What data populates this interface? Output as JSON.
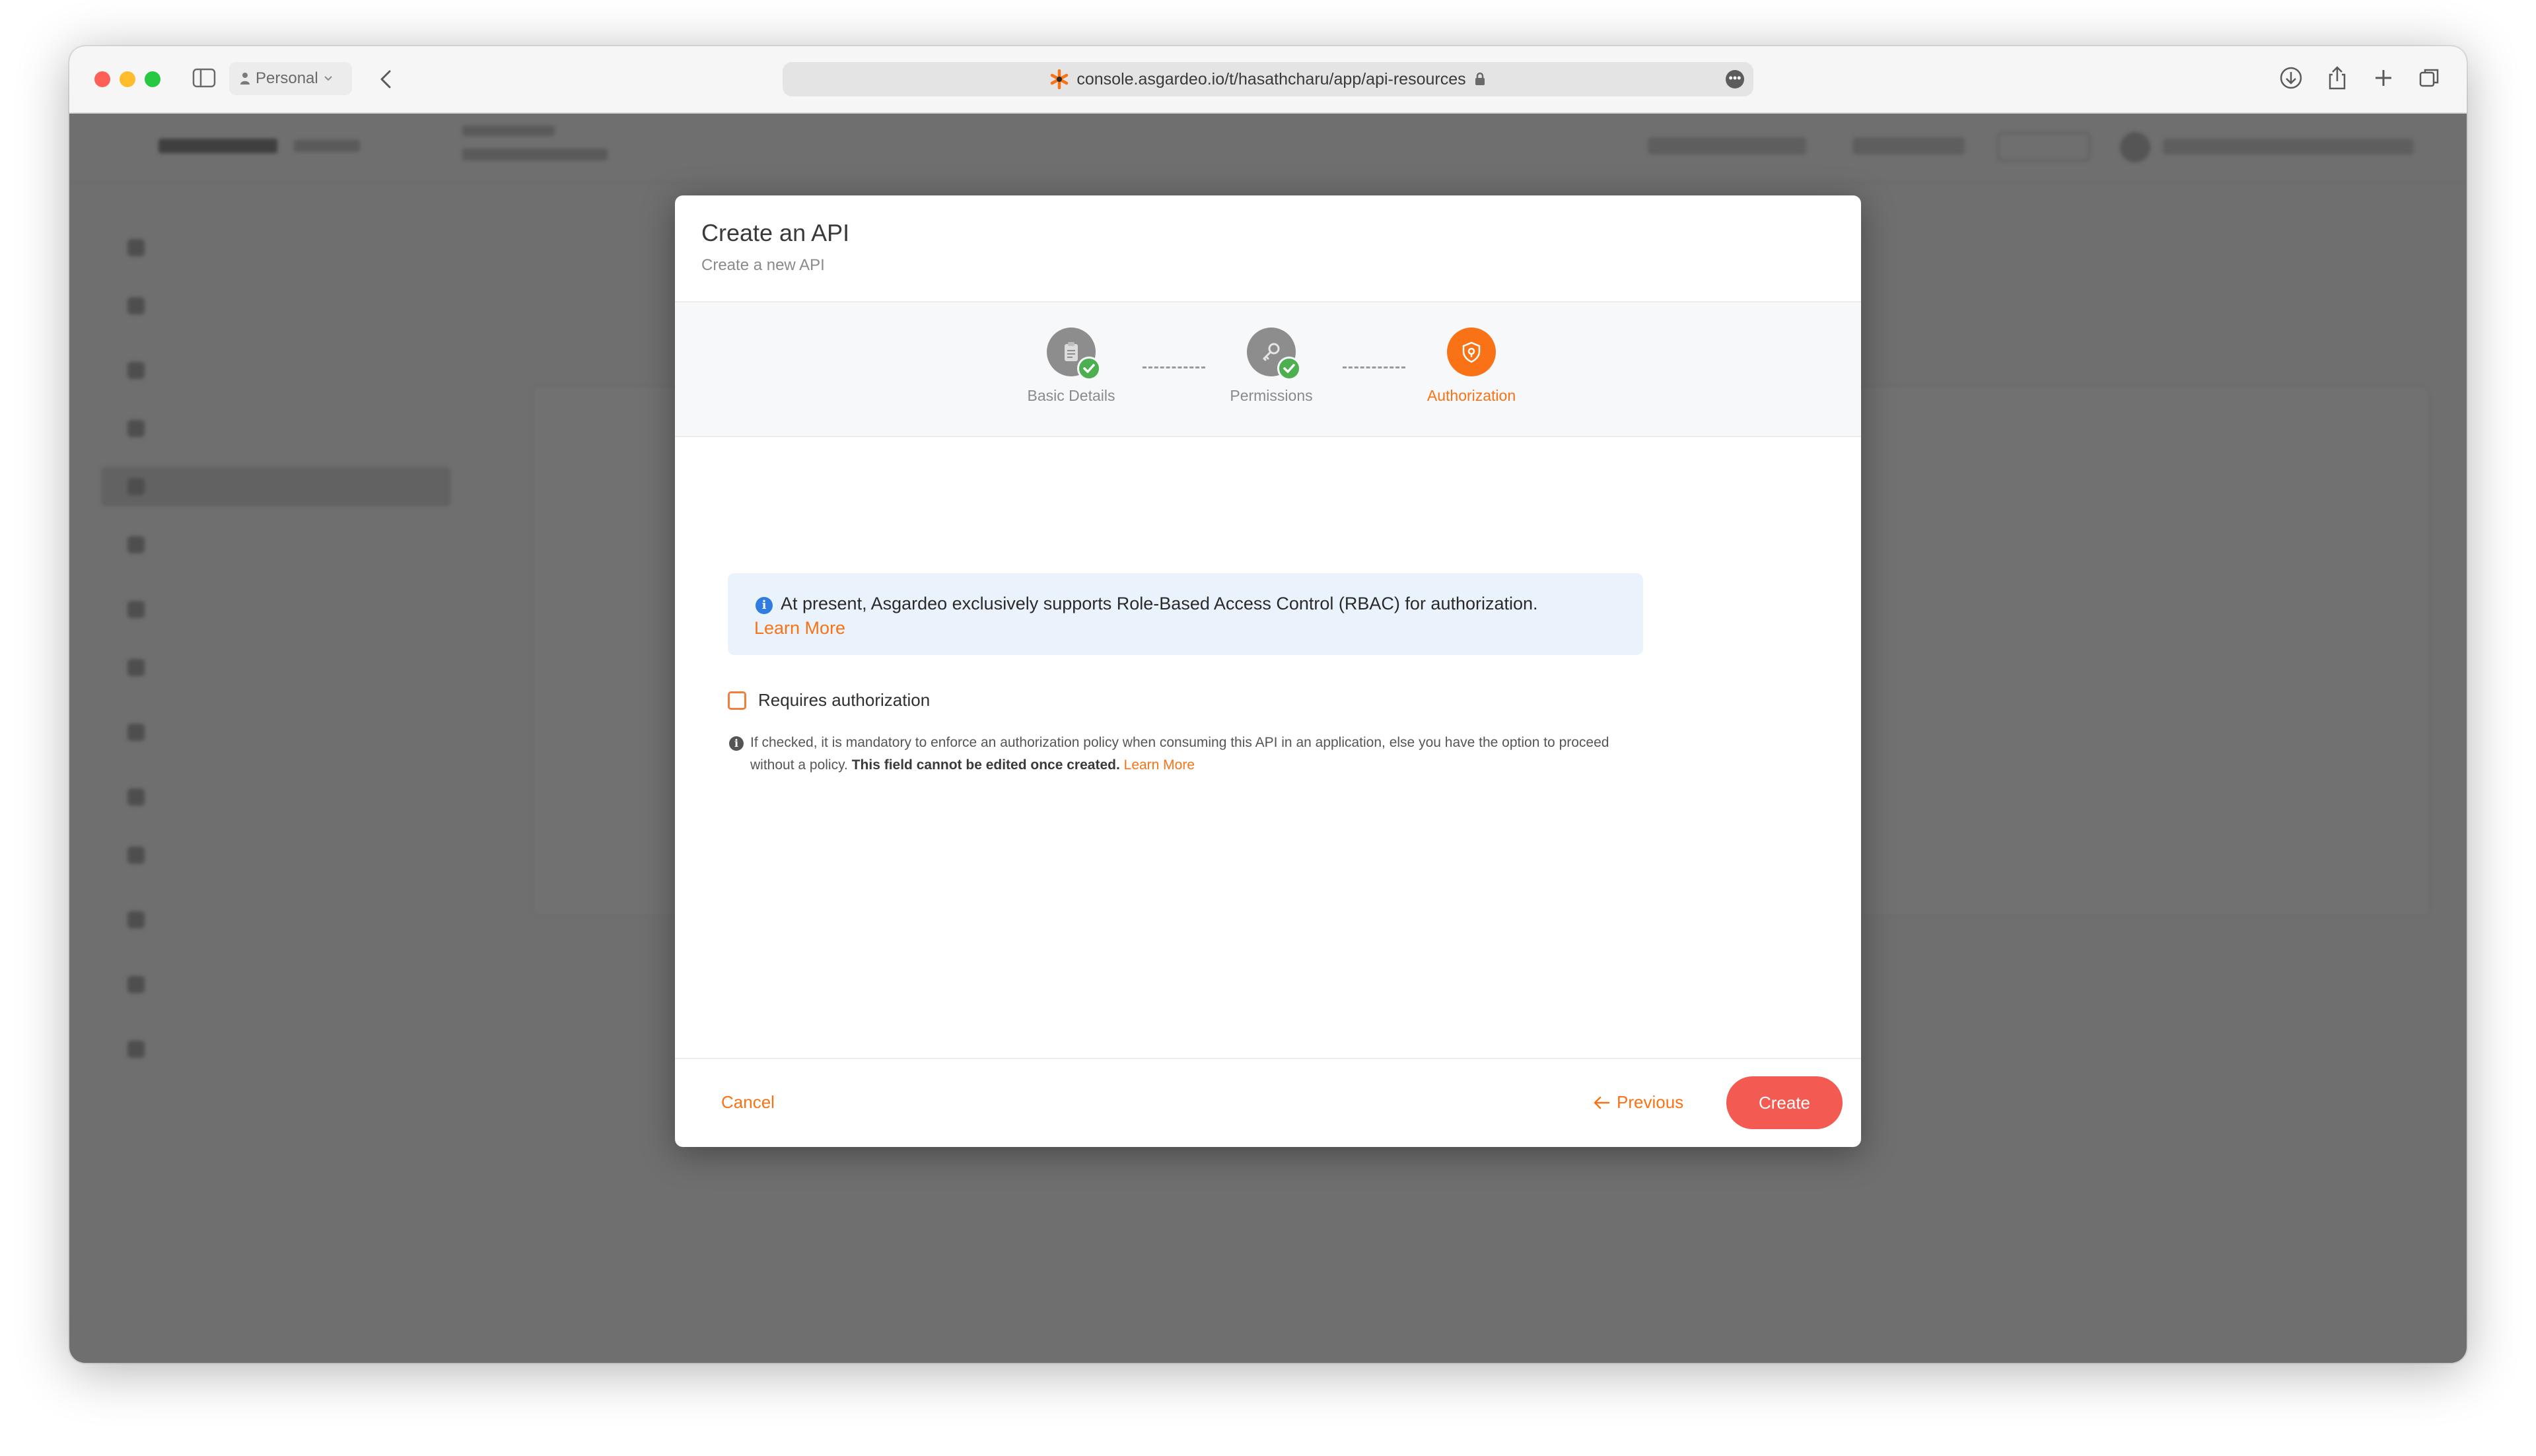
{
  "browser": {
    "profile": "Personal",
    "url": "console.asgardeo.io/t/hasathcharu/app/api-resources"
  },
  "modal": {
    "title": "Create an API",
    "subtitle": "Create a new API",
    "steps": [
      {
        "label": "Basic Details",
        "state": "completed",
        "icon": "clipboard-icon"
      },
      {
        "label": "Permissions",
        "state": "completed",
        "icon": "key-icon"
      },
      {
        "label": "Authorization",
        "state": "active",
        "icon": "shield-icon"
      }
    ],
    "info": {
      "text": "At present, Asgardeo exclusively supports Role-Based Access Control (RBAC) for authorization.",
      "link": "Learn More"
    },
    "checkbox": {
      "label": "Requires authorization",
      "checked": false
    },
    "hint": {
      "text": "If checked, it is mandatory to enforce an authorization policy when consuming this API in an application, else you have the option to proceed without a policy.",
      "bold": "This field cannot be edited once created.",
      "link": "Learn More"
    },
    "footer": {
      "cancel": "Cancel",
      "previous": "Previous",
      "create": "Create"
    }
  },
  "colors": {
    "accent": "#f97316",
    "create_button": "#f25a52",
    "success": "#4caf50",
    "info_bg": "#eaf2fb"
  }
}
